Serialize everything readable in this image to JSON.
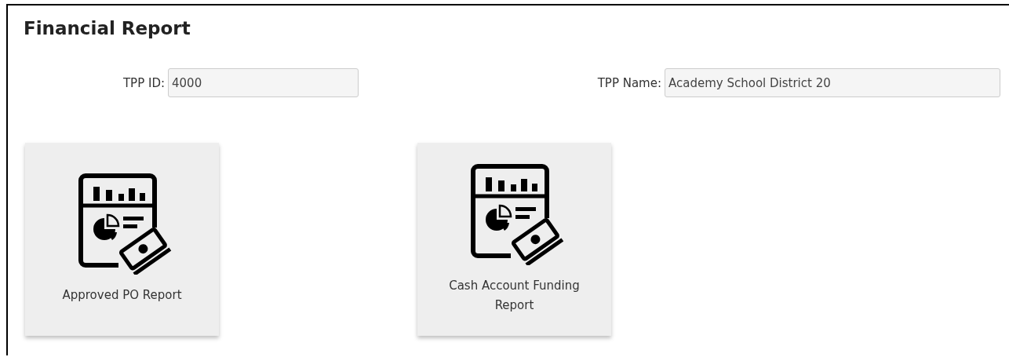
{
  "title": "Financial Report",
  "fields": [
    {
      "label": "TPP ID:",
      "value": "4000"
    },
    {
      "label": "TPP Name:",
      "value": "Academy School District 20"
    }
  ],
  "reports": [
    {
      "label": "Approved PO Report"
    },
    {
      "label": "Cash Account Funding Report"
    }
  ]
}
